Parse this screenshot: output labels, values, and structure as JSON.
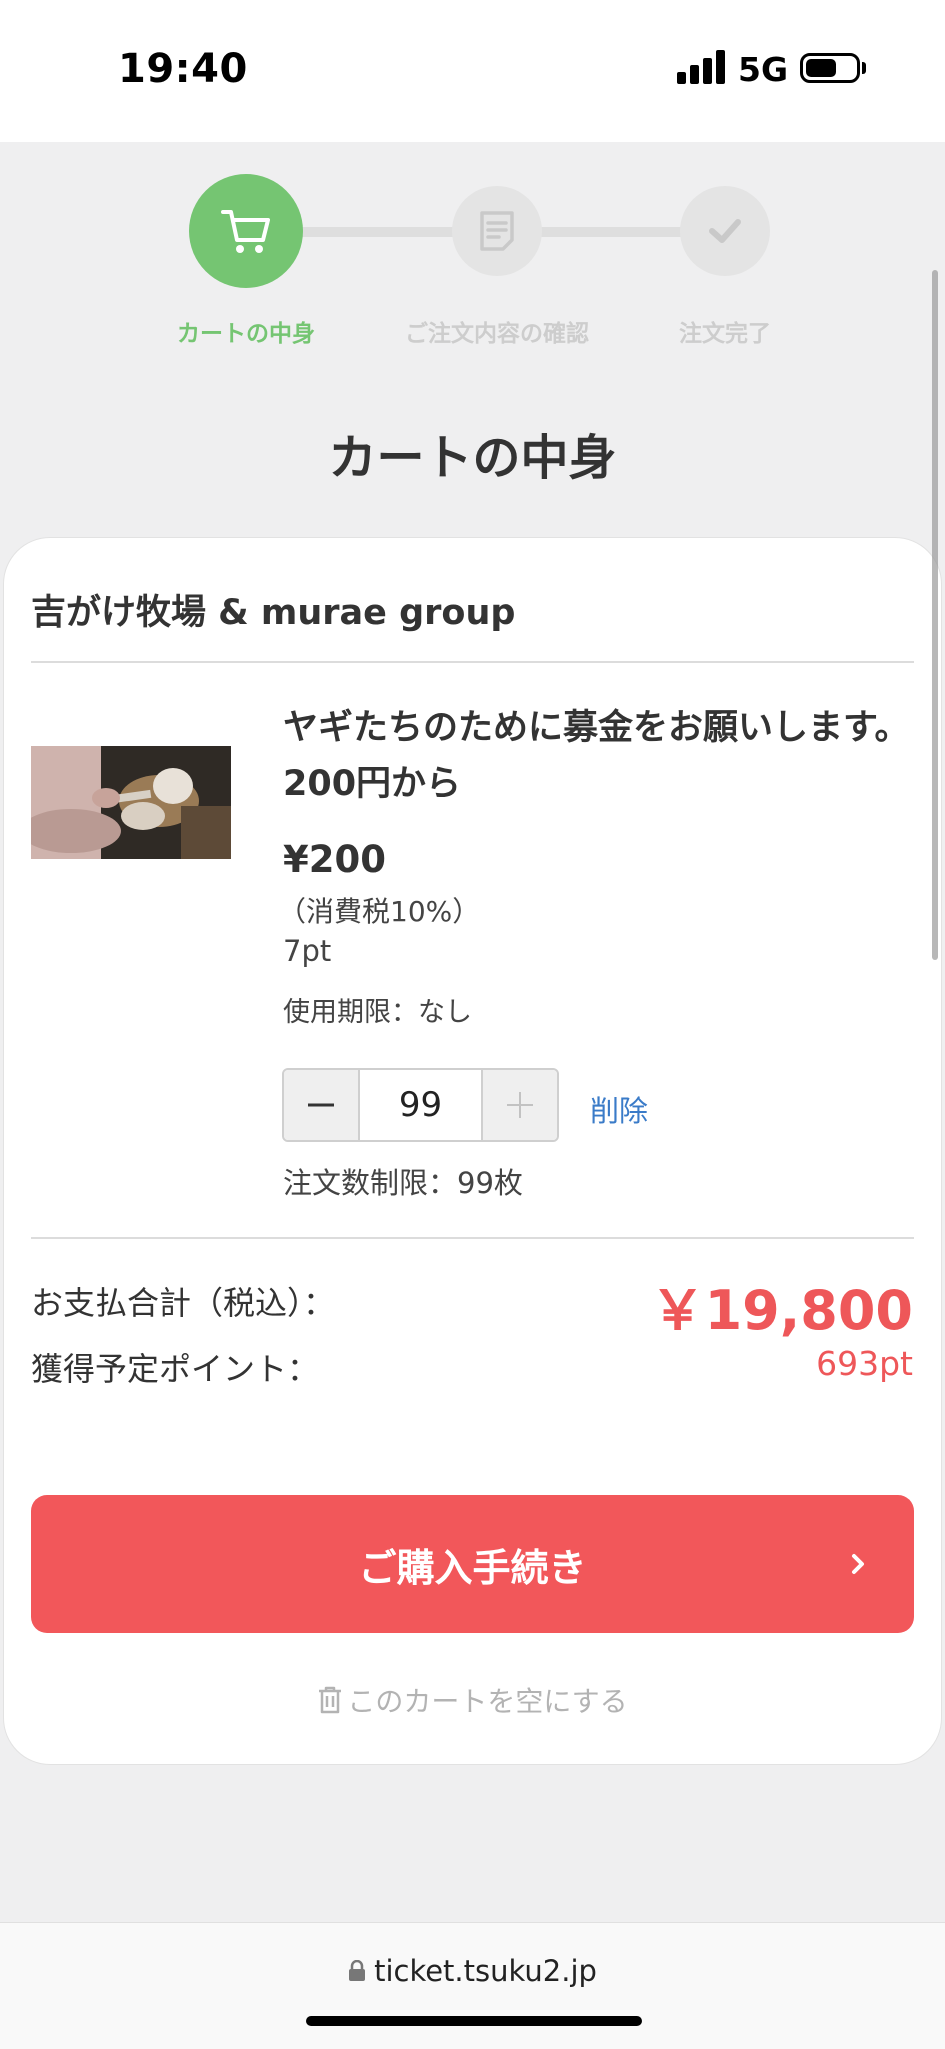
{
  "status_bar": {
    "time": "19:40",
    "network": "5G"
  },
  "stepper": {
    "steps": [
      {
        "label": "カートの中身",
        "state": "active"
      },
      {
        "label": "ご注文内容の確認",
        "state": "inactive"
      },
      {
        "label": "注文完了",
        "state": "inactive"
      }
    ],
    "active_color": "#75c572",
    "inactive_color": "#cdcdcd"
  },
  "page": {
    "title": "カートの中身"
  },
  "cart": {
    "shop_name": "吉がけ牧場 & murae group",
    "item": {
      "title": "ヤギたちのために募金をお願いします。200円から",
      "price": "¥200",
      "tax_note": "（消費税10%）",
      "points": "7pt",
      "expiry": "使用期限：なし",
      "quantity": "99",
      "delete_label": "削除",
      "order_limit": "注文数制限：99枚"
    },
    "total_label": "お支払合計（税込）：",
    "total_value": "￥19,800",
    "points_label": "獲得予定ポイント：",
    "points_value": "693pt",
    "checkout_label": "ご購入手続き",
    "empty_cart_label": "このカートを空にする",
    "accent_color": "#f2575a"
  },
  "browser": {
    "url": "ticket.tsuku2.jp"
  }
}
